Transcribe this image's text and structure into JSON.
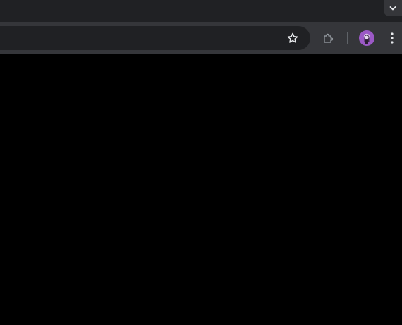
{
  "tabstrip": {
    "tab_search_icon": "chevron-down-icon"
  },
  "toolbar": {
    "bookmark_icon": "star-outline-icon",
    "extensions_icon": "puzzle-piece-icon",
    "profile_icon": "avatar",
    "menu_icon": "kebab-menu-icon"
  },
  "colors": {
    "tabstrip_bg": "#202124",
    "toolbar_bg": "#35363a",
    "omnibox_bg": "#202124",
    "icon_color": "#e8eaed",
    "avatar_bg": "#9b59c6",
    "content_bg": "#000000"
  }
}
